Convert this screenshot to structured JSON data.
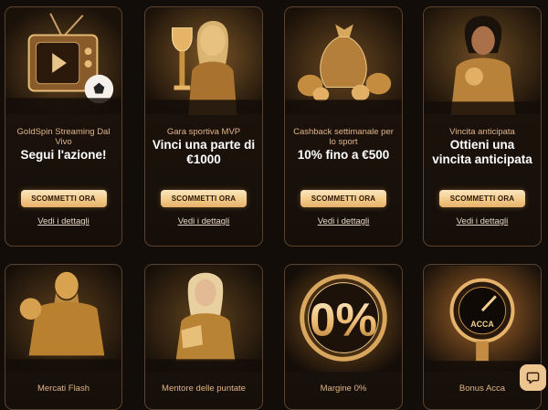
{
  "colors": {
    "accent": "#f3cb89",
    "background": "#120d09",
    "card_border": "#5a4330",
    "subtitle": "#e0b488"
  },
  "row1": [
    {
      "subtitle": "GoldSpin Streaming Dal Vivo",
      "headline": "Segui l'azione!",
      "button": "SCOMMETTI ORA",
      "link": "Vedi i dettagli",
      "icon": "tv-football-icon"
    },
    {
      "subtitle": "Gara sportiva MVP",
      "headline": "Vinci una parte di €1000",
      "button": "SCOMMETTI ORA",
      "link": "Vedi i dettagli",
      "icon": "trophy-woman-icon"
    },
    {
      "subtitle": "Cashback settimanale per lo sport",
      "headline": "10% fino a €500",
      "button": "SCOMMETTI ORA",
      "link": "Vedi i dettagli",
      "icon": "money-bag-icon"
    },
    {
      "subtitle": "Vincita anticipata",
      "headline": "Ottieni una vincita anticipata",
      "button": "SCOMMETTI ORA",
      "link": "Vedi i dettagli",
      "icon": "gold-woman-icon"
    }
  ],
  "row2": [
    {
      "subtitle": "Mercati Flash",
      "icon": "gold-statue-icon"
    },
    {
      "subtitle": "Mentore delle puntate",
      "icon": "woman-reading-icon"
    },
    {
      "subtitle": "Margine 0%",
      "art_text": "0%",
      "icon": "zero-percent-icon"
    },
    {
      "subtitle": "Bonus Acca",
      "art_text": "ACCA",
      "icon": "acca-gauge-icon"
    }
  ],
  "chat": {
    "icon": "chat-bubble-icon"
  }
}
